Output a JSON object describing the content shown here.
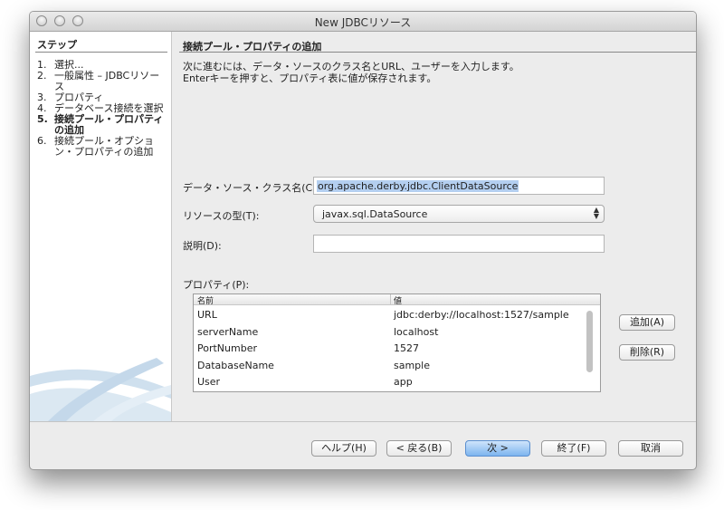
{
  "window": {
    "title": "New JDBCリソース"
  },
  "steps": {
    "header": "ステップ",
    "items": [
      {
        "num": "1.",
        "label": "選択..."
      },
      {
        "num": "2.",
        "label": "一般属性 – JDBCリソース"
      },
      {
        "num": "3.",
        "label": "プロパティ"
      },
      {
        "num": "4.",
        "label": "データベース接続を選択"
      },
      {
        "num": "5.",
        "label": "接続プール・プロパティの追加"
      },
      {
        "num": "6.",
        "label": "接続プール・オプション・プロパティの追加"
      }
    ],
    "active_index": 4
  },
  "panel": {
    "title": "接続プール・プロパティの追加",
    "desc_line1": "次に進むには、データ・ソースのクラス名とURL、ユーザーを入力します。",
    "desc_line2": "Enterキーを押すと、プロパティ表に値が保存されます。"
  },
  "form": {
    "class_label": "データ・ソース・クラス名(C):",
    "class_value": "org.apache.derby.jdbc.ClientDataSource",
    "type_label": "リソースの型(T):",
    "type_value": "javax.sql.DataSource",
    "desc_label": "説明(D):",
    "desc_value": "",
    "props_label": "プロパティ(P):"
  },
  "table": {
    "col_name": "名前",
    "col_value": "値",
    "rows": [
      {
        "name": "URL",
        "value": "jdbc:derby://localhost:1527/sample"
      },
      {
        "name": "serverName",
        "value": "localhost"
      },
      {
        "name": "PortNumber",
        "value": "1527"
      },
      {
        "name": "DatabaseName",
        "value": "sample"
      },
      {
        "name": "User",
        "value": "app"
      }
    ]
  },
  "side_buttons": {
    "add": "追加(A)",
    "remove": "削除(R)"
  },
  "footer": {
    "help": "ヘルプ(H)",
    "back": "< 戻る(B)",
    "next": "次 >",
    "finish": "終了(F)",
    "cancel": "取消"
  }
}
